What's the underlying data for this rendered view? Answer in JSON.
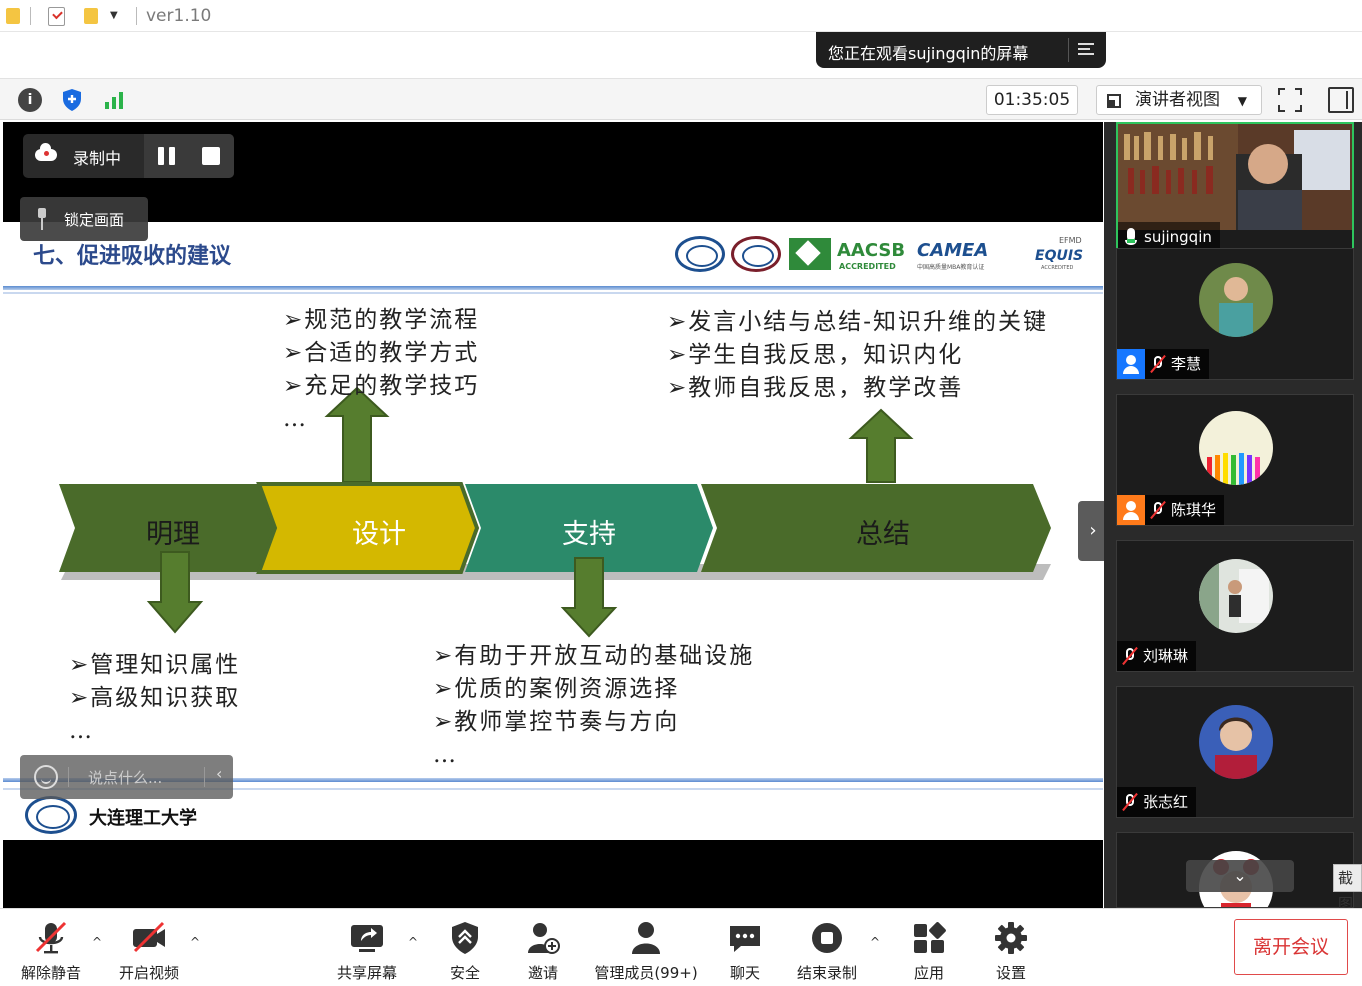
{
  "titlebar": {
    "version": "ver1.10"
  },
  "banner": {
    "watching_text": "您正在观看sujingqin的屏幕"
  },
  "toolbar": {
    "timer": "01:35:05",
    "view_mode": "演讲者视图"
  },
  "recording": {
    "status": "录制中",
    "lock_label": "锁定画面"
  },
  "chat": {
    "placeholder": "说点什么..."
  },
  "slide": {
    "title": "七、促进吸收的建议",
    "logos": {
      "aacsb": "AACSB",
      "accredited": "ACCREDITED",
      "camea": "CAMEA",
      "camea_sub": "中国高质量MBA教育认证",
      "efmd": "EFMD",
      "equis": "EQUIS",
      "equis_sub": "ACCREDITED"
    },
    "university": "大连理工大学",
    "stages": [
      "明理",
      "设计",
      "支持",
      "总结"
    ],
    "design_points": [
      "➢规范的教学流程",
      "➢合适的教学方式",
      "➢充足的教学技巧",
      "…"
    ],
    "summary_points": [
      "➢发言小结与总结-知识升维的关键",
      "➢学生自我反思，知识内化",
      "➢教师自我反思，教学改善"
    ],
    "reason_points": [
      "➢管理知识属性",
      "➢高级知识获取",
      "…"
    ],
    "support_points": [
      "➢有助于开放互动的基础设施",
      "➢优质的案例资源选择",
      "➢教师掌控节奏与方向",
      "…"
    ]
  },
  "participants": [
    {
      "name": "sujingqin",
      "mic": "on"
    },
    {
      "name": "李慧",
      "mic": "muted"
    },
    {
      "name": "陈琪华",
      "mic": "muted"
    },
    {
      "name": "刘琳琳",
      "mic": "muted"
    },
    {
      "name": "张志红",
      "mic": "muted"
    }
  ],
  "screenshot_tab": "截图",
  "controls": {
    "unmute": "解除静音",
    "start_video": "开启视频",
    "share_screen": "共享屏幕",
    "security": "安全",
    "invite": "邀请",
    "manage_members": "管理成员(99+)",
    "chat": "聊天",
    "end_recording": "结束录制",
    "apps": "应用",
    "settings": "设置",
    "leave": "离开会议"
  },
  "colors": {
    "olive": "#4a6b2a",
    "yellow": "#d4b800",
    "teal": "#2b8a6a",
    "arrow_green": "#567d2e",
    "title_blue": "#2c4a8c",
    "leave_red": "#d93434"
  }
}
